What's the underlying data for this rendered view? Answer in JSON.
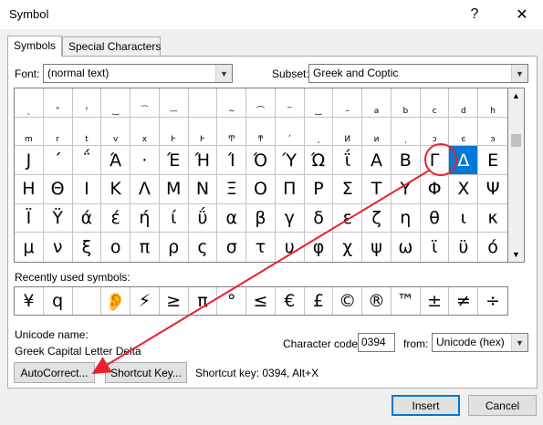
{
  "window": {
    "title": "Symbol",
    "help": "?",
    "close": "✕"
  },
  "tabs": [
    {
      "label": "Symbols"
    },
    {
      "label": "Special Characters"
    }
  ],
  "font": {
    "label": "Font:",
    "value": "(normal text)"
  },
  "subset": {
    "label": "Subset:",
    "value": "Greek and Coptic"
  },
  "grid_rows": [
    [
      "˛",
      "˜",
      "ʾ",
      "‾",
      "‾",
      "—",
      "—",
      "∼",
      "‾",
      "‾",
      "‾",
      "‾",
      "a",
      "b",
      "c",
      "d",
      "h"
    ],
    [
      "m",
      "r",
      "t",
      "v",
      "x",
      "Ͱ",
      "Ͱ",
      "Ͳ",
      "ͳ",
      "ʹ",
      "͵",
      "Ͷ",
      "ͷ",
      "ͺ",
      "ͻ",
      "ͼ",
      "ͽ"
    ],
    [
      ";",
      "Ϳ",
      "΄",
      "΅",
      "Ά",
      "·",
      "Έ",
      "Ή",
      "Ί",
      "Ό",
      "Ύ",
      "Ώ",
      "ΐ",
      "Α",
      "Β",
      "Γ",
      "Δ"
    ],
    [
      "Ε",
      "Ζ",
      "Η",
      "Θ",
      "Ι",
      "Κ",
      "Λ",
      "Μ",
      "Ν",
      "Ξ",
      "Ο",
      "Π",
      "Ρ",
      "Σ",
      "Τ",
      "Υ",
      "Φ"
    ],
    [
      "Χ",
      "Ψ",
      "Ω",
      "Ϊ",
      "Ϋ",
      "ά",
      "έ",
      "ή",
      "ί",
      "ΰ",
      "α",
      "β",
      "γ",
      "δ",
      "ε",
      "ζ",
      "η"
    ],
    [
      "θ",
      "ι",
      "κ",
      "λ",
      "μ",
      "ν",
      "ξ",
      "ο",
      "π",
      "ρ",
      "ς",
      "σ",
      "τ",
      "υ",
      "φ",
      "χ",
      "ψ"
    ]
  ],
  "grid_display": [
    [
      "˛",
      "ˮ",
      "ˀ",
      "‿",
      "⁀",
      "—",
      "",
      "∼",
      "⌒",
      "‾",
      "‿",
      "⌣",
      "a",
      "b",
      "c",
      "d",
      "h"
    ],
    [
      "m",
      "r",
      "t",
      "v",
      "x",
      "Ͱ",
      "Ͱ",
      "Ͳ",
      "ͳ",
      "ʹ",
      "͵",
      "Ͷ",
      "ͷ",
      "ͺ",
      "ͻ",
      "ͼ",
      "ͽ"
    ],
    [
      "Ϳ",
      "΄",
      "΅",
      "Ά",
      "·",
      "Έ",
      "Ή",
      "Ί",
      "Ό",
      "Ύ",
      "Ώ",
      "ΐ",
      "Α",
      "Β",
      "Γ",
      "Δ",
      "Ε"
    ],
    [
      "Η",
      "Θ",
      "Ι",
      "Κ",
      "Λ",
      "Μ",
      "Ν",
      "Ξ",
      "Ο",
      "Π",
      "Ρ",
      "Σ",
      "Τ",
      "Υ",
      "Φ",
      "Χ",
      "Ψ"
    ],
    [
      "Ϊ",
      "Ϋ",
      "ά",
      "έ",
      "ή",
      "ί",
      "ΰ",
      "α",
      "β",
      "γ",
      "δ",
      "ε",
      "ζ",
      "η",
      "θ",
      "ι",
      "κ"
    ],
    [
      "μ",
      "ν",
      "ξ",
      "ο",
      "π",
      "ρ",
      "ς",
      "σ",
      "τ",
      "υ",
      "φ",
      "χ",
      "ψ",
      "ω",
      "ϊ",
      "ϋ",
      "ό"
    ]
  ],
  "recent": {
    "label": "Recently used symbols:",
    "symbols": [
      "¥",
      "q",
      "",
      "👂",
      "⚡",
      "≥",
      "π",
      "°",
      "µ",
      "≤",
      "€",
      "£",
      "©",
      "®",
      "™",
      "±",
      "≠",
      "÷"
    ]
  },
  "unicode": {
    "name_label": "Unicode name:",
    "name_value": "Greek Capital Letter Delta"
  },
  "char_code": {
    "label": "Character code:",
    "value": "0394"
  },
  "from": {
    "label": "from:",
    "value": "Unicode (hex)"
  },
  "buttons": {
    "autocorrect": "AutoCorrect...",
    "shortcut": "Shortcut Key...",
    "insert": "Insert",
    "cancel": "Cancel"
  },
  "shortcut_text": "Shortcut key: 0394, Alt+X",
  "colors": {
    "accent": "#0078d7",
    "annotation": "#e8212b"
  }
}
